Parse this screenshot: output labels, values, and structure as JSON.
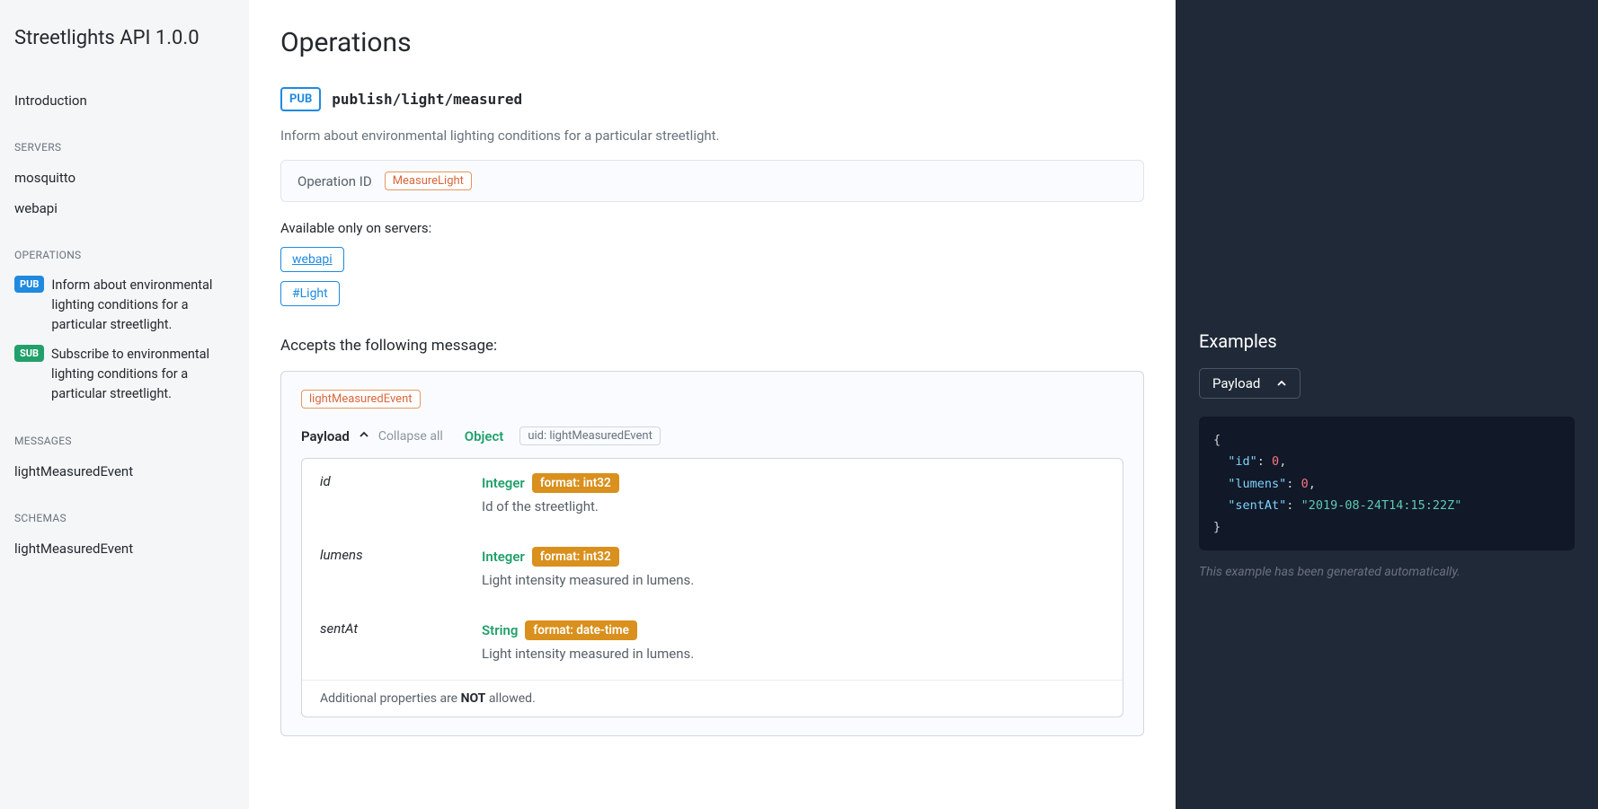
{
  "sidebar": {
    "title": "Streetlights API 1.0.0",
    "introduction": "Introduction",
    "sections": {
      "servers": {
        "label": "SERVERS",
        "items": [
          "mosquitto",
          "webapi"
        ]
      },
      "operations": {
        "label": "OPERATIONS",
        "items": [
          {
            "badge": "PUB",
            "text": "Inform about environmental lighting conditions for a particular streetlight."
          },
          {
            "badge": "SUB",
            "text": "Subscribe to environmental lighting conditions for a particular streetlight."
          }
        ]
      },
      "messages": {
        "label": "MESSAGES",
        "items": [
          "lightMeasuredEvent"
        ]
      },
      "schemas": {
        "label": "SCHEMAS",
        "items": [
          "lightMeasuredEvent"
        ]
      }
    }
  },
  "main": {
    "heading": "Operations",
    "op": {
      "badge": "PUB",
      "path": "publish/light/measured",
      "description": "Inform about environmental lighting conditions for a particular streetlight.",
      "op_id_label": "Operation ID",
      "op_id_value": "MeasureLight",
      "servers_label": "Available only on servers:",
      "servers": [
        "webapi"
      ],
      "tags": [
        "#Light"
      ],
      "accepts_label": "Accepts the following message:",
      "message_name": "lightMeasuredEvent",
      "payload_label": "Payload",
      "collapse_label": "Collapse all",
      "type_label": "Object",
      "uid_label": "uid: lightMeasuredEvent",
      "props": [
        {
          "name": "id",
          "type": "Integer",
          "format": "format: int32",
          "desc": "Id of the streetlight."
        },
        {
          "name": "lumens",
          "type": "Integer",
          "format": "format: int32",
          "desc": "Light intensity measured in lumens."
        },
        {
          "name": "sentAt",
          "type": "String",
          "format": "format: date-time",
          "desc": "Light intensity measured in lumens."
        }
      ],
      "additional_pre": "Additional properties are ",
      "additional_not": "NOT",
      "additional_post": " allowed."
    }
  },
  "right": {
    "title": "Examples",
    "toggle": "Payload",
    "code": {
      "id_key": "\"id\"",
      "id_val": "0",
      "lumens_key": "\"lumens\"",
      "lumens_val": "0",
      "sent_key": "\"sentAt\"",
      "sent_val": "\"2019-08-24T14:15:22Z\""
    },
    "note": "This example has been generated automatically."
  }
}
